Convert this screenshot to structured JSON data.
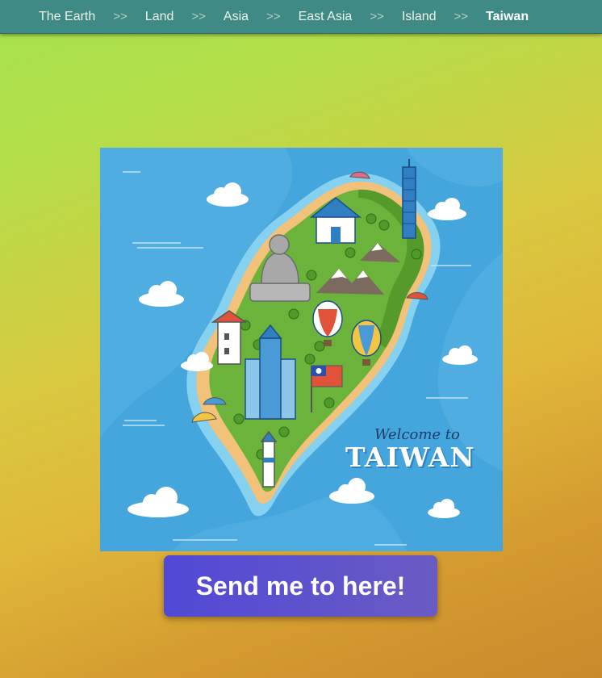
{
  "breadcrumb": {
    "items": [
      {
        "label": "The Earth"
      },
      {
        "label": "Land"
      },
      {
        "label": "Asia"
      },
      {
        "label": "East Asia"
      },
      {
        "label": "Island"
      },
      {
        "label": "Taiwan"
      }
    ],
    "separator": ">>"
  },
  "map": {
    "image_icon": "taiwan-map-illustration",
    "welcome_text": "Welcome to",
    "title_text": "TAIWAN"
  },
  "action": {
    "send_label": "Send me to here!"
  },
  "colors": {
    "header_bg": "#3f8a84",
    "button_bg": "#5149d6",
    "sea": "#45a6de",
    "land": "#6bb33a",
    "beach": "#f2c27a"
  }
}
